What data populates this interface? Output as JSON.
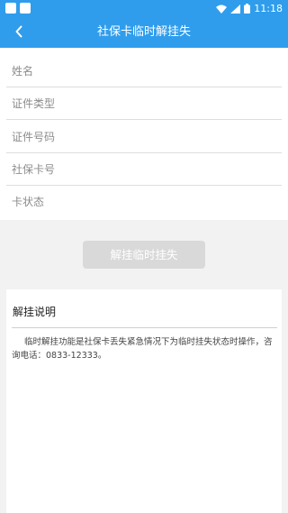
{
  "status_bar": {
    "time": "11:18",
    "icons": [
      "app-square-icon",
      "app-square-icon",
      "wifi-icon",
      "signal-icon",
      "battery-icon"
    ]
  },
  "header": {
    "title": "社保卡临时解挂失",
    "back_icon": "chevron-left-icon"
  },
  "form": {
    "fields": [
      {
        "label": "姓名"
      },
      {
        "label": "证件类型"
      },
      {
        "label": "证件号码"
      },
      {
        "label": "社保卡号"
      },
      {
        "label": "卡状态"
      }
    ]
  },
  "action": {
    "submit_label": "解挂临时挂失"
  },
  "info": {
    "title": "解挂说明",
    "text": "临时解挂功能是社保卡丢失紧急情况下为临时挂失状态时操作，咨询电话：0833-12333。"
  },
  "colors": {
    "primary": "#2f9dec",
    "button_disabled": "#d9d9d9",
    "page_bg": "#f2f2f2"
  }
}
